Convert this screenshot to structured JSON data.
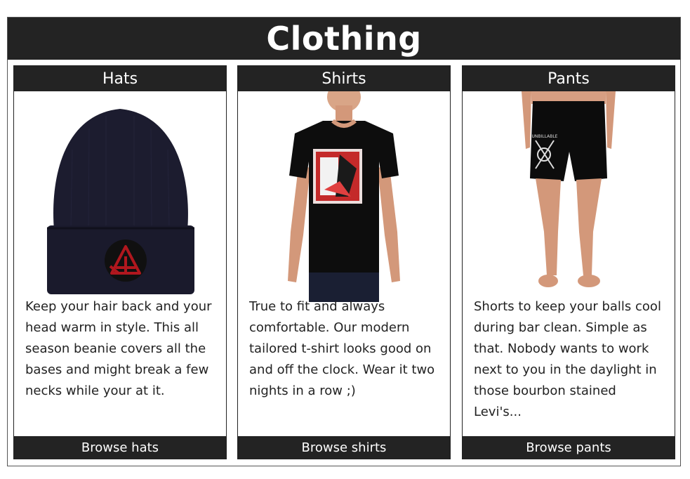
{
  "section": {
    "title": "Clothing"
  },
  "cards": [
    {
      "title": "Hats",
      "description": "Keep your hair back and your head warm in style. This all season beanie covers all the bases and might break a few necks while your at it.",
      "button": "Browse hats",
      "image": "beanie-photo"
    },
    {
      "title": "Shirts",
      "description": "True to fit and always comfortable. Our modern tailored t-shirt looks good on and off the clock. Wear it two nights in a row ;)",
      "button": "Browse shirts",
      "image": "t-shirt-photo"
    },
    {
      "title": "Pants",
      "description": "Shorts to keep your balls cool during bar clean. Simple as that. Nobody wants to work next to you in the daylight in those bourbon stained Levi's...",
      "button": "Browse pants",
      "image": "shorts-photo"
    }
  ],
  "colors": {
    "header_bg": "#232323",
    "beanie": "#1b1b2e",
    "emblem": "#b0171e"
  }
}
